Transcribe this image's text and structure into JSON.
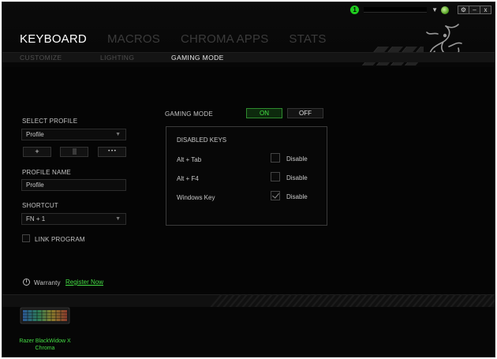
{
  "titlebar": {
    "notification_count": "1",
    "caret": "▼",
    "buttons": {
      "settings": "⚙",
      "minimize": "–",
      "close": "x"
    }
  },
  "main_tabs": [
    {
      "label": "KEYBOARD",
      "active": true
    },
    {
      "label": "MACROS",
      "active": false
    },
    {
      "label": "CHROMA APPS",
      "active": false
    },
    {
      "label": "STATS",
      "active": false
    }
  ],
  "sub_tabs": [
    {
      "label": "CUSTOMIZE",
      "active": false
    },
    {
      "label": "LIGHTING",
      "active": false
    },
    {
      "label": "GAMING MODE",
      "active": true
    }
  ],
  "profile": {
    "select_label": "SELECT PROFILE",
    "selected": "Profile",
    "add_button": "+",
    "more_button": "• • •",
    "name_label": "PROFILE NAME",
    "name_value": "Profile",
    "shortcut_label": "SHORTCUT",
    "shortcut_value": "FN + 1",
    "link_program_label": "LINK PROGRAM"
  },
  "gaming_mode": {
    "label": "GAMING MODE",
    "on_label": "ON",
    "off_label": "OFF",
    "state": "ON",
    "disabled_keys_title": "DISABLED KEYS",
    "keys": [
      {
        "name": "Alt + Tab",
        "option": "Disable",
        "checked": false
      },
      {
        "name": "Alt + F4",
        "option": "Disable",
        "checked": false
      },
      {
        "name": "Windows Key",
        "option": "Disable",
        "checked": true
      }
    ]
  },
  "warranty": {
    "label": "Warranty",
    "link": "Register Now",
    "icon": "info-icon"
  },
  "device": {
    "name_line1": "Razer BlackWidow X",
    "name_line2": "Chroma"
  },
  "colors": {
    "accent_green": "#44dd44",
    "background": "#050505",
    "active_text": "#ffffff",
    "inactive_tab": "#3b3b3b"
  }
}
